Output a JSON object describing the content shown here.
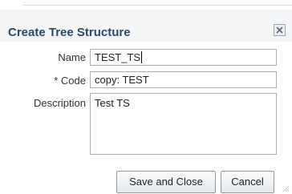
{
  "dialog": {
    "title": "Create Tree Structure",
    "close_icon": "close-icon"
  },
  "form": {
    "name_label": "Name",
    "name_value": "TEST_TS",
    "code_label": "* Code",
    "code_value": "copy: TEST",
    "description_label": "Description",
    "description_value": "Test TS"
  },
  "buttons": {
    "save_close_label": "Save and Close",
    "cancel_label": "Cancel"
  },
  "colors": {
    "title": "#2b4a71",
    "titlebar_bg": "#f4f5f7",
    "input_border": "#a8b0b8"
  }
}
